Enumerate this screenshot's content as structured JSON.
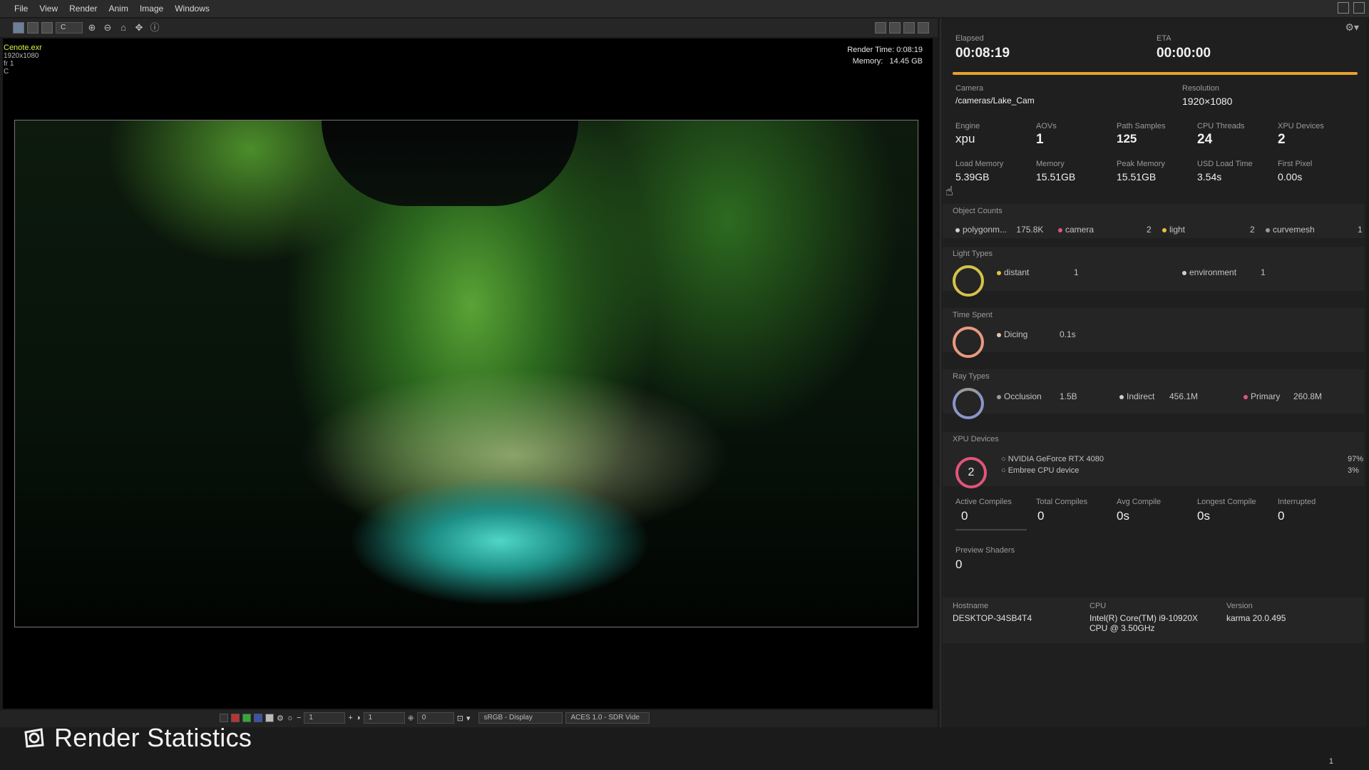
{
  "menu": [
    "File",
    "View",
    "Render",
    "Anim",
    "Image",
    "Windows"
  ],
  "toolbar": {
    "channel_value": "C"
  },
  "viewport": {
    "file_name": "Cenote.exr",
    "resolution_text": "1920x1080",
    "frame_text": "fr 1",
    "channel_text": "C",
    "render_time": "Render Time: 0:08:19",
    "memory_label": "Memory:",
    "memory_value": "14.45 GB"
  },
  "bottom_bar": {
    "exposure_value": "1",
    "gamma_value": "1",
    "offset_value": "0",
    "display": "sRGB - Display",
    "view_transform": "ACES 1.0 - SDR Vide"
  },
  "footer": {
    "title": "Render Statistics",
    "status_number": "1"
  },
  "stats": {
    "elapsed": {
      "label": "Elapsed",
      "value": "00:08:19"
    },
    "eta": {
      "label": "ETA",
      "value": "00:00:00"
    },
    "progress": 1.0,
    "camera": {
      "label": "Camera",
      "value": "/cameras/Lake_Cam"
    },
    "resolution": {
      "label": "Resolution",
      "value": "1920×1080"
    },
    "engine": {
      "label": "Engine",
      "value": "xpu"
    },
    "aovs": {
      "label": "AOVs",
      "value": "1"
    },
    "path_samples": {
      "label": "Path Samples",
      "value": "125"
    },
    "cpu_threads": {
      "label": "CPU Threads",
      "value": "24"
    },
    "xpu_devices_count": {
      "label": "XPU Devices",
      "value": "2"
    },
    "load_memory": {
      "label": "Load Memory",
      "value": "5.39GB"
    },
    "memory": {
      "label": "Memory",
      "value": "15.51GB"
    },
    "peak_memory": {
      "label": "Peak Memory",
      "value": "15.51GB"
    },
    "usd_load_time": {
      "label": "USD Load Time",
      "value": "3.54s"
    },
    "first_pixel": {
      "label": "First Pixel",
      "value": "0.00s"
    },
    "object_counts": {
      "label": "Object Counts",
      "items": [
        {
          "name": "polygonm...",
          "value": "175.8K",
          "color": "#cfcfcf"
        },
        {
          "name": "camera",
          "value": "2",
          "color": "#e0567a"
        },
        {
          "name": "light",
          "value": "2",
          "color": "#e8c23a"
        },
        {
          "name": "curvemesh",
          "value": "1",
          "color": "#9a9a9a"
        }
      ]
    },
    "light_types": {
      "label": "Light Types",
      "ring_color": "#d6c24a",
      "items": [
        {
          "name": "distant",
          "value": "1",
          "color": "#e8c23a"
        },
        {
          "name": "environment",
          "value": "1",
          "color": "#cfcfcf"
        }
      ]
    },
    "time_spent": {
      "label": "Time Spent",
      "ring_color": "#e89a80",
      "items": [
        {
          "name": "Dicing",
          "value": "0.1s",
          "color": "#e8c9a0"
        }
      ]
    },
    "ray_types": {
      "label": "Ray Types",
      "ring_color": "#8a95c8",
      "items": [
        {
          "name": "Occlusion",
          "value": "1.5B",
          "color": "#9a9a9a"
        },
        {
          "name": "Indirect",
          "value": "456.1M",
          "color": "#cfcfcf"
        },
        {
          "name": "Primary",
          "value": "260.8M",
          "color": "#e0567a"
        }
      ]
    },
    "xpu_devices": {
      "label": "XPU Devices",
      "count": "2",
      "ring_color": "#e0567a",
      "items": [
        {
          "name": "NVIDIA GeForce RTX 4080",
          "value": "97%"
        },
        {
          "name": "Embree CPU device",
          "value": "3%"
        }
      ]
    },
    "active_compiles": {
      "label": "Active Compiles",
      "value": "0"
    },
    "total_compiles": {
      "label": "Total Compiles",
      "value": "0"
    },
    "avg_compile": {
      "label": "Avg Compile",
      "value": "0s"
    },
    "longest_compile": {
      "label": "Longest Compile",
      "value": "0s"
    },
    "interrupted": {
      "label": "Interrupted",
      "value": "0"
    },
    "preview_shaders": {
      "label": "Preview Shaders",
      "value": "0"
    },
    "hostname": {
      "label": "Hostname",
      "value": "DESKTOP-34SB4T4"
    },
    "cpu": {
      "label": "CPU",
      "value_line1": "Intel(R) Core(TM) i9-10920X",
      "value_line2": "CPU @ 3.50GHz"
    },
    "version": {
      "label": "Version",
      "value": "karma 20.0.495"
    }
  }
}
